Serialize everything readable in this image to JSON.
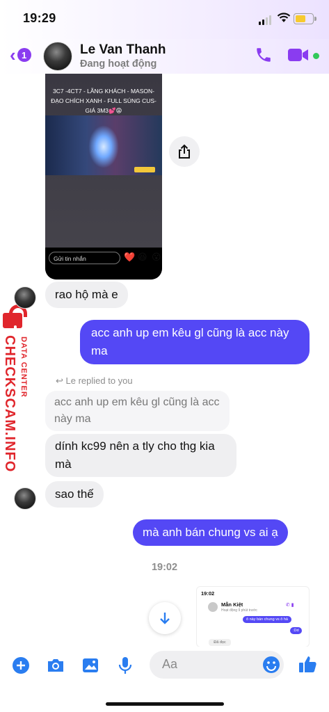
{
  "status_bar": {
    "time": "19:29"
  },
  "header": {
    "back_count": "1",
    "contact_name": "Le Van Thanh",
    "contact_status": "Đang hoạt động"
  },
  "story": {
    "caption": "3C7 -4CT7 - LÃNG KHÁCH - MASON- ĐẠO CHÍCH XANH - FULL SÚNG CUS- GIÁ 3M3💕😩",
    "input_placeholder": "Gửi tin nhắn",
    "reactions": [
      "❤️",
      "😆",
      "😮"
    ]
  },
  "watermark": {
    "main": "CHECKSCAM.INFO",
    "sub": "DATA CENTER"
  },
  "messages": [
    {
      "id": "m1",
      "dir": "in",
      "text": "rao hộ mà e"
    },
    {
      "id": "m2",
      "dir": "out",
      "text": "acc anh up em kêu gl cũng là acc này ma"
    },
    {
      "id": "m3",
      "dir": "in",
      "reply_note": "Le replied to you",
      "quoted": "acc anh up em kêu gl cũng là acc này ma",
      "text": "dính kc99 nên a tly cho thg kia mà"
    },
    {
      "id": "m4",
      "dir": "in",
      "text": "sao thế"
    },
    {
      "id": "m5",
      "dir": "out",
      "text": "mà anh bán chung vs ai ạ"
    }
  ],
  "timestamp": "19:02",
  "screenshot_preview": {
    "time": "19:02",
    "name": "Mẫn Kiệt",
    "subtitle": "Hoạt động 9 phút trước",
    "msg1": "ô này bán chung vs ô hả",
    "msg2": ":Dd",
    "tag": "Đã đọc"
  },
  "composer": {
    "placeholder": "Aa"
  },
  "colors": {
    "accent": "#8a3cf0",
    "outgoing": "#5448f5",
    "incoming": "#efeff1",
    "watermark": "#e0262c"
  }
}
